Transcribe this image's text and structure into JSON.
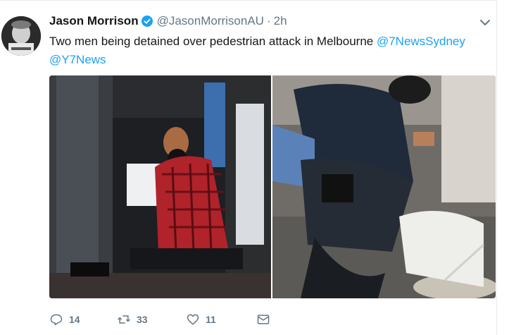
{
  "tweet": {
    "author_name": "Jason Morrison",
    "author_handle": "@JasonMorrisonAU",
    "separator": "·",
    "time": "2h",
    "text_plain": "Two men being detained over pedestrian attack in Melbourne ",
    "mention_1": "@7NewsSydney",
    "mention_2": "@Y7News"
  },
  "actions": {
    "reply_count": "14",
    "retweet_count": "33",
    "like_count": "11"
  },
  "icons": {
    "verified": "verified-badge-icon",
    "caret": "chevron-down-icon",
    "reply": "reply-icon",
    "retweet": "retweet-icon",
    "like": "heart-icon",
    "message": "envelope-icon"
  },
  "colors": {
    "link": "#1da1f2",
    "muted": "#657786",
    "text": "#14171a"
  }
}
